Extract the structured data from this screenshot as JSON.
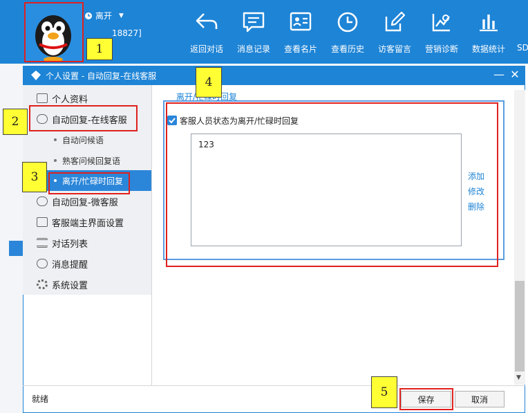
{
  "topbar": {
    "status": "离开",
    "user_id_fragment": "18827]",
    "tools": [
      {
        "label": "返回对话",
        "icon": "back-arrow-icon"
      },
      {
        "label": "消息记录",
        "icon": "message-icon"
      },
      {
        "label": "查看名片",
        "icon": "card-icon"
      },
      {
        "label": "查看历史",
        "icon": "clock-icon"
      },
      {
        "label": "访客留言",
        "icon": "edit-icon"
      },
      {
        "label": "营销诊断",
        "icon": "chart-line-icon"
      },
      {
        "label": "数据统计",
        "icon": "bar-chart-icon"
      },
      {
        "label": "SD"
      }
    ]
  },
  "dialog": {
    "title": "个人设置 - 自动回复-在线客服",
    "min": "—",
    "close": "✕"
  },
  "sidebar": {
    "items": [
      {
        "label": "个人资料"
      },
      {
        "label": "自动回复-在线客服"
      },
      {
        "label": "自动问候语"
      },
      {
        "label": "熟客问候回复语"
      },
      {
        "label": "离开/忙碌时回复"
      },
      {
        "label": "自动回复-微客服"
      },
      {
        "label": "客服端主界面设置"
      },
      {
        "label": "对话列表"
      },
      {
        "label": "消息提醒"
      },
      {
        "label": "系统设置"
      }
    ]
  },
  "main": {
    "heading": "离开/忙碌时回复",
    "checkbox_label": "客服人员状态为离开/忙碌时回复",
    "reply_text": "123",
    "links": {
      "add": "添加",
      "edit": "修改",
      "delete": "删除"
    }
  },
  "footer": {
    "status": "就绪",
    "save": "保存",
    "cancel": "取消"
  },
  "annotations": [
    "1",
    "2",
    "3",
    "4",
    "5"
  ]
}
